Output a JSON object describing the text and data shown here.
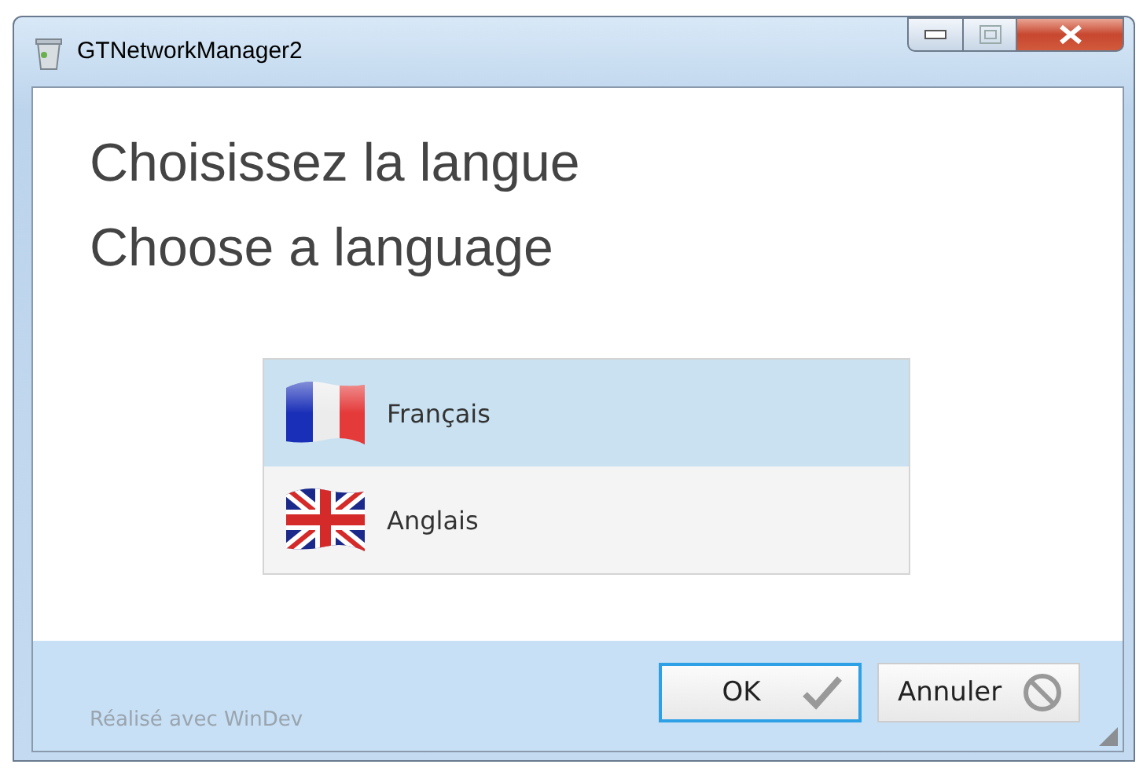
{
  "window": {
    "title": "GTNetworkManager2"
  },
  "headings": [
    "Choisissez la langue",
    "Choose a language"
  ],
  "languages": [
    {
      "label": "Français",
      "kind": "fr",
      "selected": true
    },
    {
      "label": "Anglais",
      "kind": "uk",
      "selected": false
    }
  ],
  "footer": {
    "credit": "Réalisé avec WinDev"
  },
  "buttons": [
    {
      "label": "OK",
      "kind": "ok",
      "focused": true
    },
    {
      "label": "Annuler",
      "kind": "cancel",
      "focused": false
    }
  ]
}
